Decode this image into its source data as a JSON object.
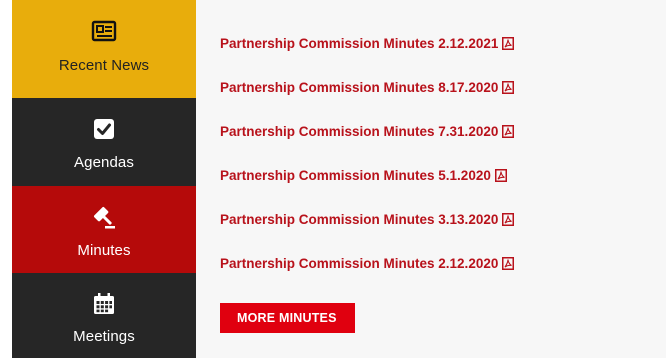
{
  "colors": {
    "recent_news_bg": "#e8ad0c",
    "nav_dark_bg": "#262626",
    "nav_active_bg": "#b50a0a",
    "link_color": "#b8121b",
    "button_bg": "#e0000f",
    "content_bg": "#f7f7f7"
  },
  "sidebar": {
    "items": [
      {
        "label": "Recent News",
        "icon": "newspaper-icon",
        "active": false
      },
      {
        "label": "Agendas",
        "icon": "checkbox-icon",
        "active": false
      },
      {
        "label": "Minutes",
        "icon": "gavel-icon",
        "active": true
      },
      {
        "label": "Meetings",
        "icon": "calendar-icon",
        "active": false
      }
    ]
  },
  "main": {
    "links": [
      {
        "label": "Partnership Commission Minutes 2.12.2021",
        "icon": "pdf-icon"
      },
      {
        "label": "Partnership Commission Minutes 8.17.2020",
        "icon": "pdf-icon"
      },
      {
        "label": "Partnership Commission Minutes 7.31.2020",
        "icon": "pdf-icon"
      },
      {
        "label": "Partnership Commission Minutes 5.1.2020",
        "icon": "pdf-icon"
      },
      {
        "label": "Partnership Commission Minutes 3.13.2020",
        "icon": "pdf-icon"
      },
      {
        "label": "Partnership Commission Minutes 2.12.2020",
        "icon": "pdf-icon"
      }
    ],
    "more_button_label": "MORE MINUTES"
  }
}
